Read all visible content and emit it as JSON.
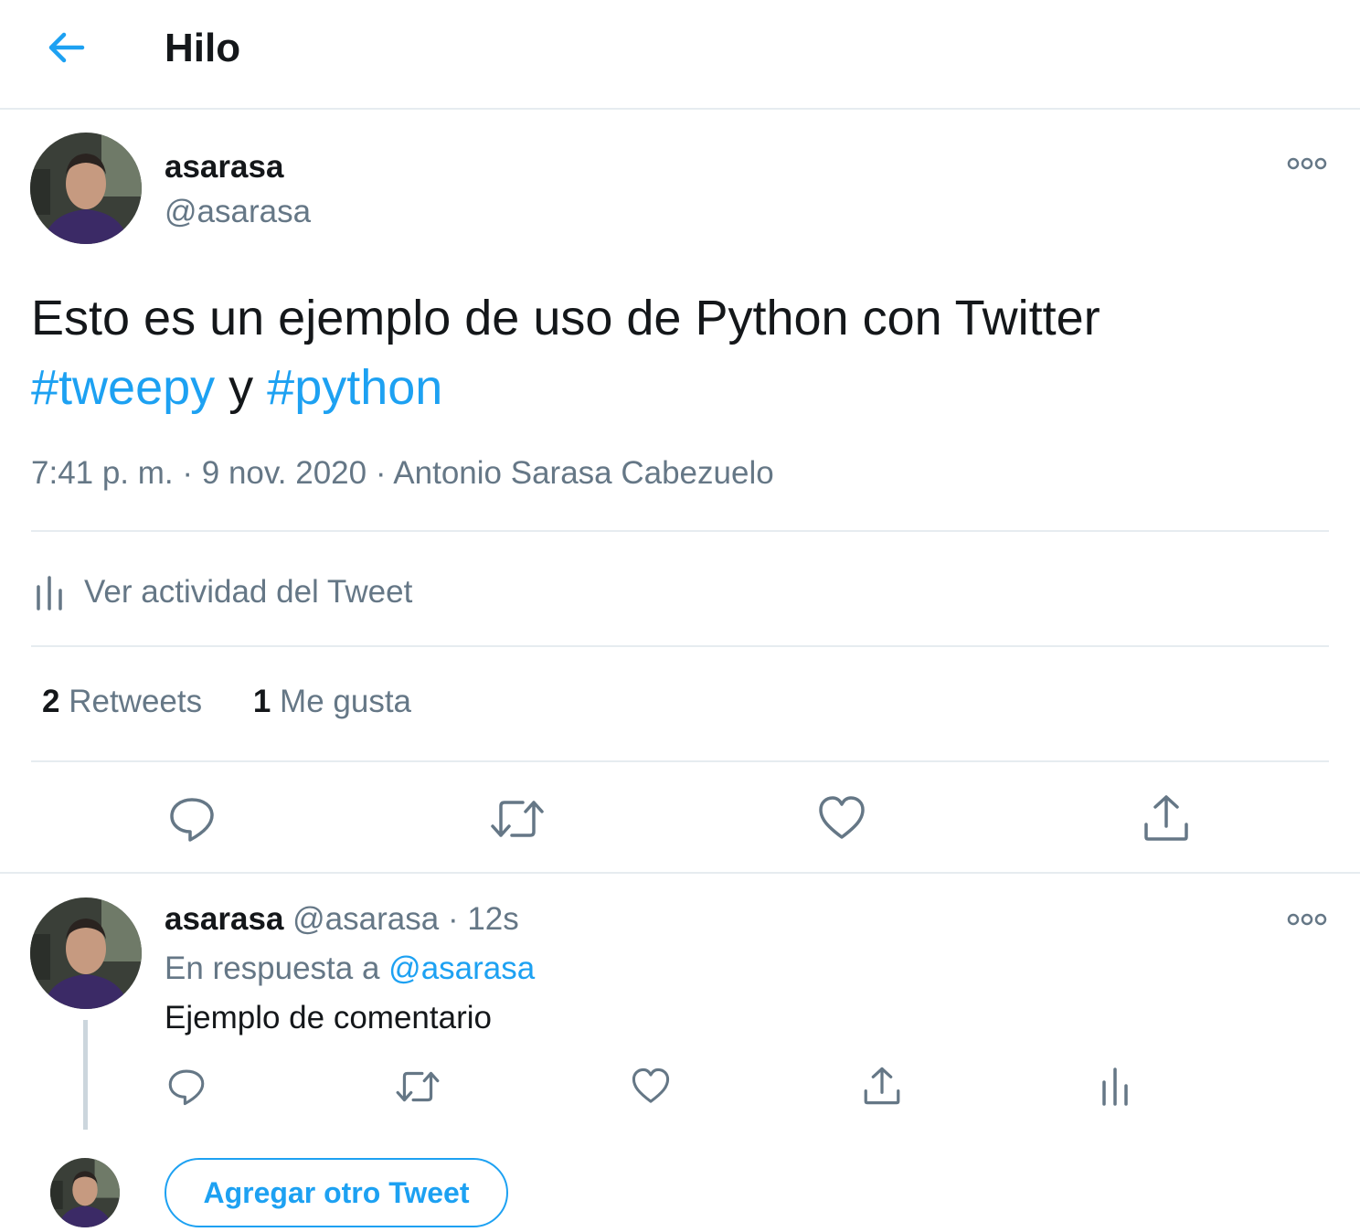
{
  "header": {
    "title": "Hilo",
    "back_icon": "arrow-left-icon"
  },
  "tweet": {
    "display_name": "asarasa",
    "handle": "@asarasa",
    "text_main": "Esto es un ejemplo de uso de Python con Twitter",
    "hashtag_1": "#tweepy",
    "text_joiner": "y",
    "hashtag_2": "#python",
    "time": "7:41 p. m.",
    "separator": "·",
    "date": "9 nov. 2020",
    "source": "Antonio Sarasa Cabezuelo",
    "activity_label": "Ver actividad del Tweet",
    "retweets_count": "2",
    "retweets_label": "Retweets",
    "likes_count": "1",
    "likes_label": "Me gusta",
    "actions": [
      "reply-icon",
      "retweet-icon",
      "like-icon",
      "share-icon"
    ]
  },
  "reply": {
    "display_name": "asarasa",
    "handle": "@asarasa",
    "separator": "·",
    "time_ago": "12s",
    "in_reply_prefix": "En respuesta a",
    "in_reply_handle": "@asarasa",
    "text": "Ejemplo de comentario",
    "actions": [
      "reply-icon",
      "retweet-icon",
      "like-icon",
      "share-icon",
      "analytics-icon"
    ]
  },
  "composer": {
    "add_button_label": "Agregar otro Tweet"
  },
  "colors": {
    "accent": "#1da1f2",
    "text": "#14171a",
    "secondary": "#657786",
    "border": "#e6ecf0"
  }
}
